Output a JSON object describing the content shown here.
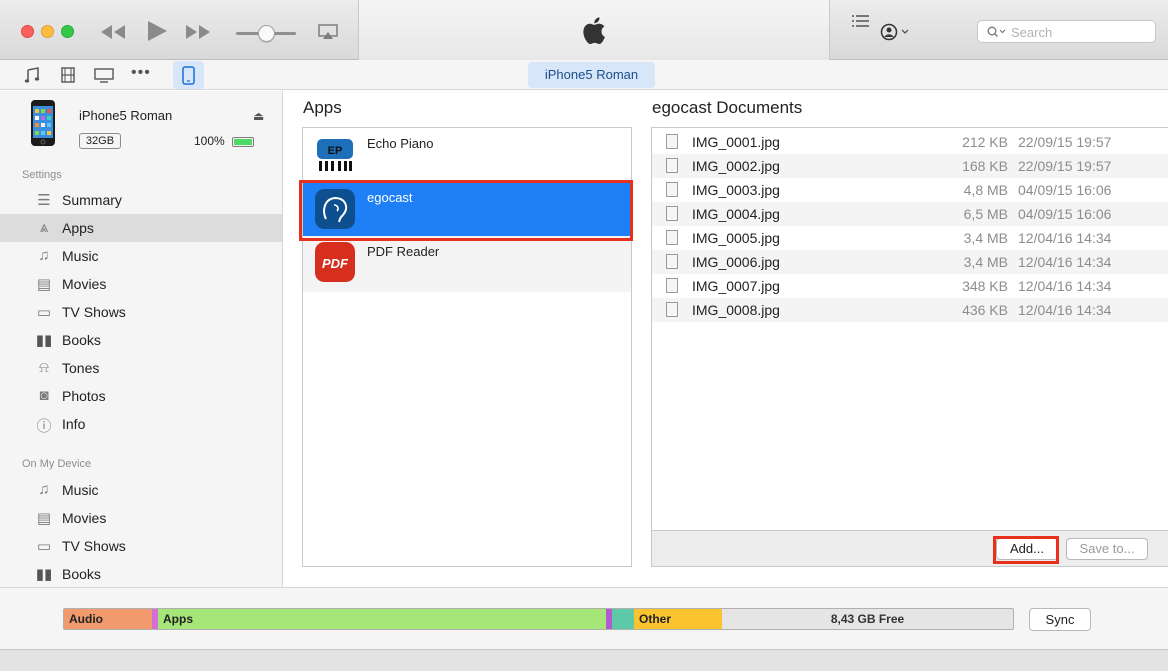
{
  "toolbar": {
    "search_placeholder": "Search",
    "device_pill": "iPhone5 Roman"
  },
  "device": {
    "name": "iPhone5 Roman",
    "capacity": "32GB",
    "battery": "100%"
  },
  "sidebar": {
    "settings_header": "Settings",
    "settings_items": [
      {
        "label": "Summary",
        "icon": "summary-icon",
        "glyph": "☰"
      },
      {
        "label": "Apps",
        "icon": "apps-icon",
        "glyph": "A"
      },
      {
        "label": "Music",
        "icon": "music-icon",
        "glyph": "♫"
      },
      {
        "label": "Movies",
        "icon": "movies-icon",
        "glyph": "▤"
      },
      {
        "label": "TV Shows",
        "icon": "tv-icon",
        "glyph": "▭"
      },
      {
        "label": "Books",
        "icon": "books-icon",
        "glyph": "▮▮"
      },
      {
        "label": "Tones",
        "icon": "bell-icon",
        "glyph": "♪"
      },
      {
        "label": "Photos",
        "icon": "camera-icon",
        "glyph": "◙"
      },
      {
        "label": "Info",
        "icon": "info-icon",
        "glyph": "ⓘ"
      }
    ],
    "device_header": "On My Device",
    "device_items": [
      {
        "label": "Music",
        "icon": "music-icon",
        "glyph": "♫"
      },
      {
        "label": "Movies",
        "icon": "movies-icon",
        "glyph": "▤"
      },
      {
        "label": "TV Shows",
        "icon": "tv-icon",
        "glyph": "▭"
      },
      {
        "label": "Books",
        "icon": "books-icon",
        "glyph": "▮▮"
      }
    ]
  },
  "apps": {
    "title": "Apps",
    "items": [
      {
        "name": "Echo Piano"
      },
      {
        "name": "egocast"
      },
      {
        "name": "PDF Reader"
      }
    ]
  },
  "documents": {
    "title": "egocast Documents",
    "files": [
      {
        "name": "IMG_0001.jpg",
        "size": "212 KB",
        "date": "22/09/15 19:57"
      },
      {
        "name": "IMG_0002.jpg",
        "size": "168 KB",
        "date": "22/09/15 19:57"
      },
      {
        "name": "IMG_0003.jpg",
        "size": "4,8 MB",
        "date": "04/09/15 16:06"
      },
      {
        "name": "IMG_0004.jpg",
        "size": "6,5 MB",
        "date": "04/09/15 16:06"
      },
      {
        "name": "IMG_0005.jpg",
        "size": "3,4 MB",
        "date": "12/04/16 14:34"
      },
      {
        "name": "IMG_0006.jpg",
        "size": "3,4 MB",
        "date": "12/04/16 14:34"
      },
      {
        "name": "IMG_0007.jpg",
        "size": "348 KB",
        "date": "12/04/16 14:34"
      },
      {
        "name": "IMG_0008.jpg",
        "size": "436 KB",
        "date": "12/04/16 14:34"
      }
    ],
    "add_label": "Add...",
    "save_label": "Save to..."
  },
  "storage": {
    "audio_label": "Audio",
    "apps_label": "Apps",
    "other_label": "Other",
    "free_label": "8,43 GB Free",
    "sync_label": "Sync",
    "colors": {
      "audio": "#f09a6e",
      "apps": "#a6e678",
      "other": "#fbc42f",
      "free": "#e5e5e5"
    }
  }
}
